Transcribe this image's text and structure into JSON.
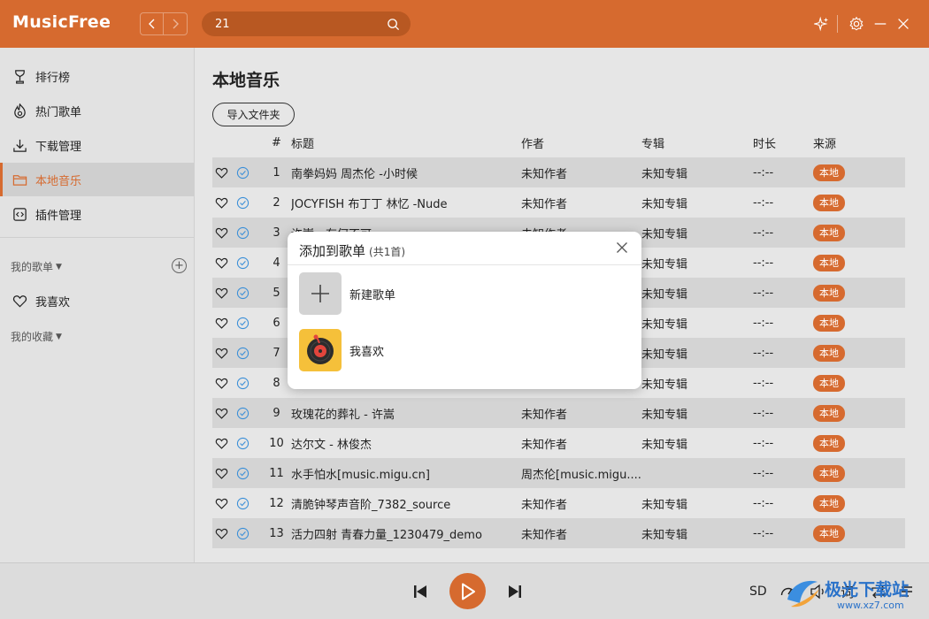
{
  "app": {
    "title": "MusicFree",
    "accent": "#d66a2f"
  },
  "header": {
    "search": {
      "value": "21",
      "placeholder": ""
    },
    "icons": [
      "back-arrow-icon",
      "forward-arrow-icon",
      "search-icon",
      "sparkle-icon",
      "gear-icon",
      "minimize-icon",
      "close-icon"
    ]
  },
  "sidebar": {
    "items": [
      {
        "label": "排行榜",
        "icon": "trophy-icon",
        "active": false
      },
      {
        "label": "热门歌单",
        "icon": "flame-icon",
        "active": false
      },
      {
        "label": "下载管理",
        "icon": "download-icon",
        "active": false
      },
      {
        "label": "本地音乐",
        "icon": "folder-icon",
        "active": true
      },
      {
        "label": "插件管理",
        "icon": "plugin-icon",
        "active": false
      }
    ],
    "my_playlists": "我的歌单",
    "favorite": "我喜欢",
    "my_collections": "我的收藏"
  },
  "main": {
    "title": "本地音乐",
    "import_button": "导入文件夹",
    "columns": {
      "num": "#",
      "title": "标题",
      "artist": "作者",
      "album": "专辑",
      "duration": "时长",
      "source": "来源"
    },
    "rows": [
      {
        "num": "1",
        "title": "南拳妈妈 周杰伦 -小时候",
        "artist": "未知作者",
        "album": "未知专辑",
        "duration": "--:--",
        "source": "本地"
      },
      {
        "num": "2",
        "title": "JOCYFISH 布丁丁 林忆 -Nude",
        "artist": "未知作者",
        "album": "未知专辑",
        "duration": "--:--",
        "source": "本地"
      },
      {
        "num": "3",
        "title": "许嵩 - 有何不可",
        "artist": "未知作者",
        "album": "未知专辑",
        "duration": "--:--",
        "source": "本地"
      },
      {
        "num": "4",
        "title": "",
        "artist": "",
        "album": "未知专辑",
        "duration": "--:--",
        "source": "本地"
      },
      {
        "num": "5",
        "title": "",
        "artist": "",
        "album": "未知专辑",
        "duration": "--:--",
        "source": "本地"
      },
      {
        "num": "6",
        "title": "",
        "artist": "",
        "album": "未知专辑",
        "duration": "--:--",
        "source": "本地"
      },
      {
        "num": "7",
        "title": "",
        "artist": "",
        "album": "未知专辑",
        "duration": "--:--",
        "source": "本地"
      },
      {
        "num": "8",
        "title": "",
        "artist": "",
        "album": "未知专辑",
        "duration": "--:--",
        "source": "本地"
      },
      {
        "num": "9",
        "title": "玫瑰花的葬礼 - 许嵩",
        "artist": "未知作者",
        "album": "未知专辑",
        "duration": "--:--",
        "source": "本地"
      },
      {
        "num": "10",
        "title": "达尔文 - 林俊杰",
        "artist": "未知作者",
        "album": "未知专辑",
        "duration": "--:--",
        "source": "本地"
      },
      {
        "num": "11",
        "title": "水手怕水[music.migu.cn]",
        "artist": "周杰伦[music.migu....",
        "album": "",
        "duration": "--:--",
        "source": "本地"
      },
      {
        "num": "12",
        "title": "清脆钟琴声音阶_7382_source",
        "artist": "未知作者",
        "album": "未知专辑",
        "duration": "--:--",
        "source": "本地"
      },
      {
        "num": "13",
        "title": "活力四射 青春力量_1230479_demo",
        "artist": "未知作者",
        "album": "未知专辑",
        "duration": "--:--",
        "source": "本地"
      }
    ]
  },
  "dialog": {
    "title": "添加到歌单",
    "subtitle": "(共1首)",
    "items": [
      {
        "label": "新建歌单",
        "icon": "plus-icon"
      },
      {
        "label": "我喜欢",
        "icon": "vinyl-record-icon"
      }
    ]
  },
  "player": {
    "quality": "SD",
    "lyric": "词",
    "icons": [
      "previous-icon",
      "play-icon",
      "next-icon",
      "speed-icon",
      "volume-icon",
      "lyric-icon",
      "playlist-icon"
    ]
  },
  "watermark": {
    "text": "极光下载站",
    "url": "www.xz7.com"
  }
}
